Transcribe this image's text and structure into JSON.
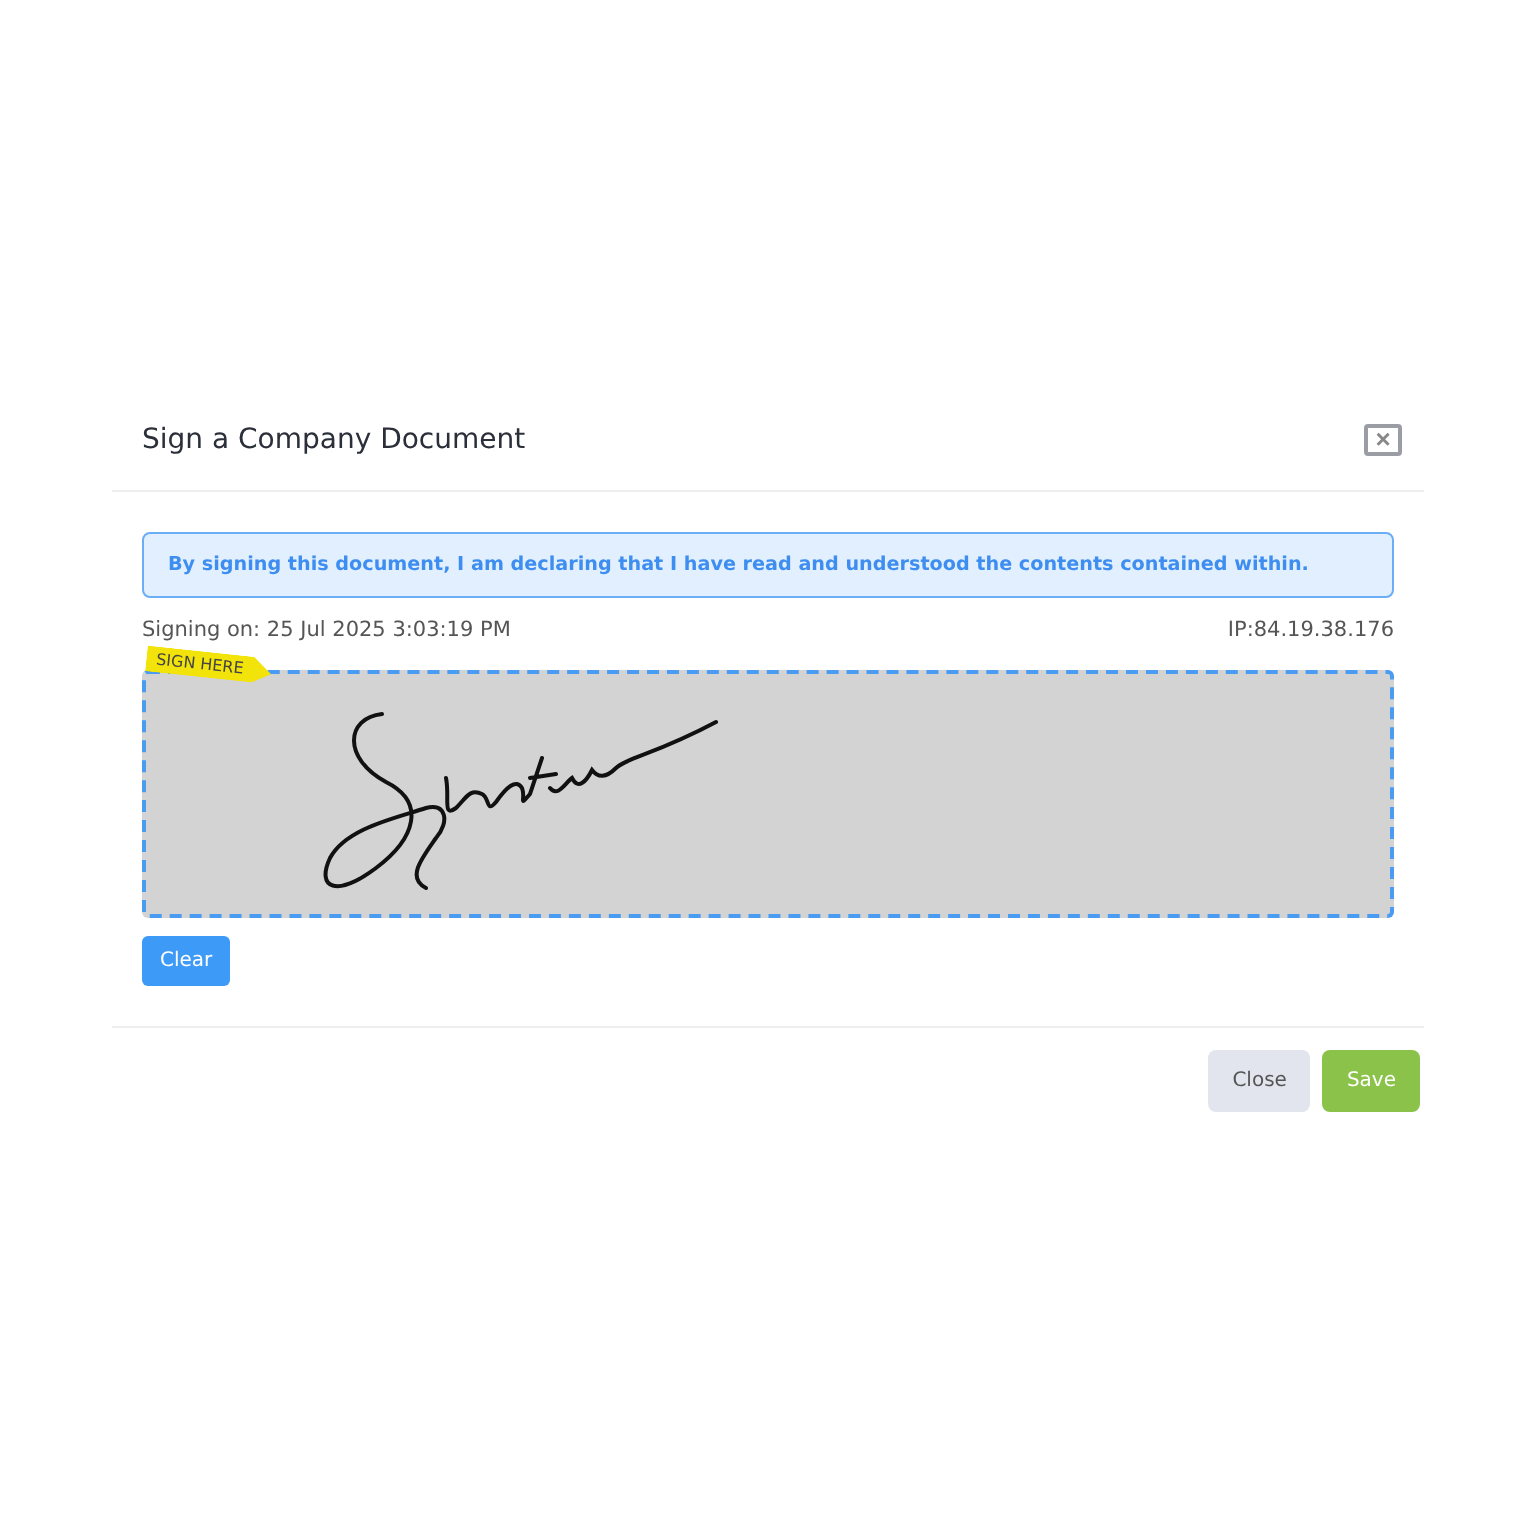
{
  "dialog": {
    "title": "Sign a Company Document",
    "close_icon": "×"
  },
  "notice": "By signing this document, I am declaring that I have read and understood the contents contained within.",
  "signing_on": "Signing on: 25 Jul 2025 3:03:19 PM",
  "ip": "IP:84.19.38.176",
  "pad": {
    "tag": "SIGN HERE"
  },
  "clear_button": "Clear",
  "buttons": [
    {
      "label": "Close",
      "kind": "secondary"
    },
    {
      "label": "Save",
      "kind": "primary"
    }
  ]
}
